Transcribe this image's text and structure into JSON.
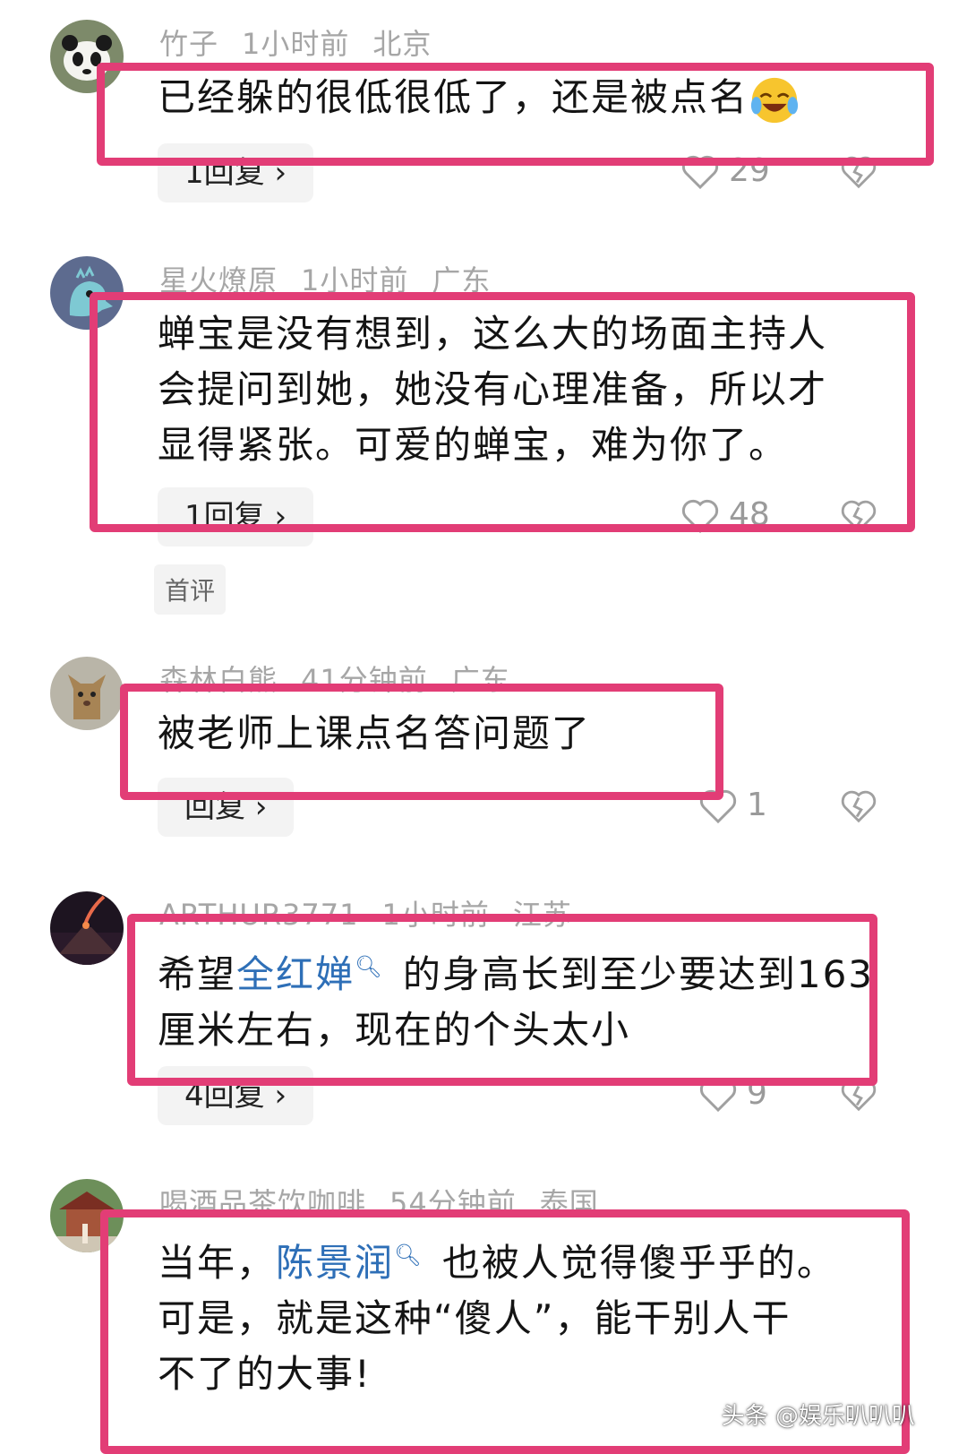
{
  "comments": [
    {
      "username": "竹子",
      "time": "1小时前",
      "location": "北京",
      "text": "已经躲的很低很低了，还是被点名",
      "reply": "1回复 ›",
      "likes": "29"
    },
    {
      "username": "星火燎原",
      "time": "1小时前",
      "location": "广东",
      "lines": [
        "蝉宝是没有想到，这么大的场面主持人",
        "会提问到她，她没有心理准备，所以才",
        "显得紧张。可爱的蝉宝，难为你了。"
      ],
      "reply": "1回复 ›",
      "likes": "48",
      "tag": "首评"
    },
    {
      "username": "森林白熊",
      "time": "41分钟前",
      "location": "广东",
      "text": "被老师上课点名答问题了",
      "reply": "回复 ›",
      "likes": "1"
    },
    {
      "username": "ARTHUR3771",
      "time": "1小时前",
      "location": "江苏",
      "line1_pre": "希望",
      "mention": "全红婵",
      "line1_post": " 的身高长到至少要达到163",
      "line2": "厘米左右，现在的个头太小",
      "reply": "4回复 ›",
      "likes": "9"
    },
    {
      "username": "喝酒品茶饮咖啡",
      "time": "54分钟前",
      "location": "泰国",
      "line1_pre": "当年，",
      "mention": "陈景润",
      "line1_post": " 也被人觉得傻乎乎的。",
      "line2": "可是，就是这种“傻人”，能干别人干",
      "line3": "不了的大事!"
    }
  ],
  "watermark": "头条 @娱乐叭叭叭",
  "colors": {
    "highlight": "#e23d76",
    "mention": "#2e6fb7",
    "meta": "#a6a6a6"
  }
}
